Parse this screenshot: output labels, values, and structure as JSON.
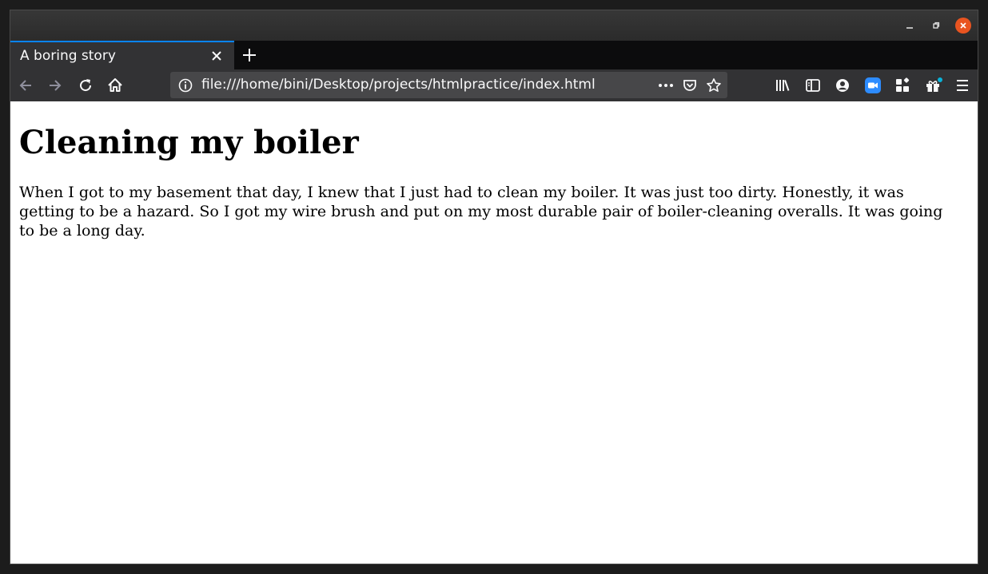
{
  "browser": {
    "tab": {
      "title": "A boring story"
    },
    "url": "file:///home/bini/Desktop/projects/htmlpractice/index.html",
    "accent_color": "#0a84ff",
    "window_close_color": "#e95420",
    "icons": [
      "back-icon",
      "forward-icon",
      "reload-icon",
      "home-icon",
      "info-icon",
      "more-icon",
      "pocket-icon",
      "star-icon",
      "library-icon",
      "sidebar-icon",
      "account-icon",
      "zoom-icon",
      "extensions-icon",
      "gift-icon",
      "menu-icon"
    ]
  },
  "page": {
    "heading": "Cleaning my boiler",
    "paragraph": "When I got to my basement that day, I knew that I just had to clean my boiler. It was just too dirty. Honestly, it was getting to be a hazard. So I got my wire brush and put on my most durable pair of boiler-cleaning overalls. It was going to be a long day."
  }
}
